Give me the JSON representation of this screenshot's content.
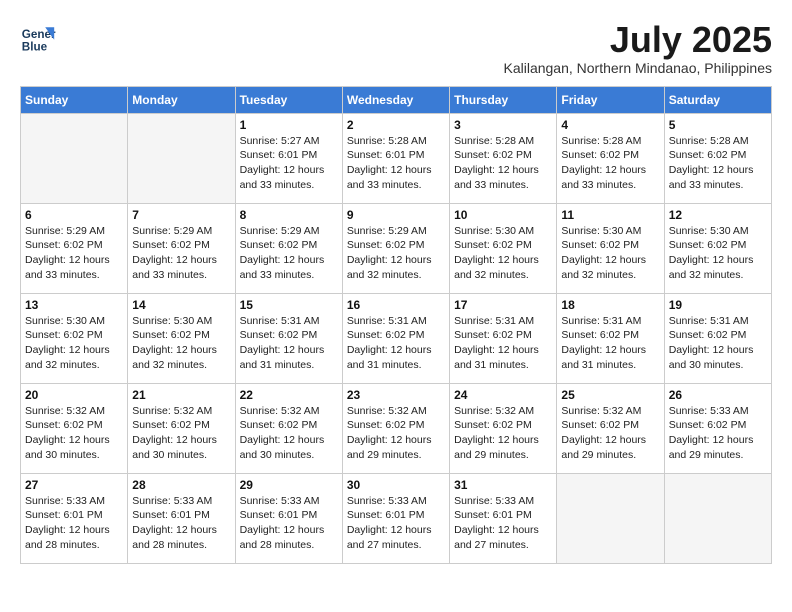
{
  "header": {
    "logo_line1": "General",
    "logo_line2": "Blue",
    "month": "July 2025",
    "location": "Kalilangan, Northern Mindanao, Philippines"
  },
  "weekdays": [
    "Sunday",
    "Monday",
    "Tuesday",
    "Wednesday",
    "Thursday",
    "Friday",
    "Saturday"
  ],
  "weeks": [
    [
      {
        "day": "",
        "info": ""
      },
      {
        "day": "",
        "info": ""
      },
      {
        "day": "1",
        "info": "Sunrise: 5:27 AM\nSunset: 6:01 PM\nDaylight: 12 hours and 33 minutes."
      },
      {
        "day": "2",
        "info": "Sunrise: 5:28 AM\nSunset: 6:01 PM\nDaylight: 12 hours and 33 minutes."
      },
      {
        "day": "3",
        "info": "Sunrise: 5:28 AM\nSunset: 6:02 PM\nDaylight: 12 hours and 33 minutes."
      },
      {
        "day": "4",
        "info": "Sunrise: 5:28 AM\nSunset: 6:02 PM\nDaylight: 12 hours and 33 minutes."
      },
      {
        "day": "5",
        "info": "Sunrise: 5:28 AM\nSunset: 6:02 PM\nDaylight: 12 hours and 33 minutes."
      }
    ],
    [
      {
        "day": "6",
        "info": "Sunrise: 5:29 AM\nSunset: 6:02 PM\nDaylight: 12 hours and 33 minutes."
      },
      {
        "day": "7",
        "info": "Sunrise: 5:29 AM\nSunset: 6:02 PM\nDaylight: 12 hours and 33 minutes."
      },
      {
        "day": "8",
        "info": "Sunrise: 5:29 AM\nSunset: 6:02 PM\nDaylight: 12 hours and 33 minutes."
      },
      {
        "day": "9",
        "info": "Sunrise: 5:29 AM\nSunset: 6:02 PM\nDaylight: 12 hours and 32 minutes."
      },
      {
        "day": "10",
        "info": "Sunrise: 5:30 AM\nSunset: 6:02 PM\nDaylight: 12 hours and 32 minutes."
      },
      {
        "day": "11",
        "info": "Sunrise: 5:30 AM\nSunset: 6:02 PM\nDaylight: 12 hours and 32 minutes."
      },
      {
        "day": "12",
        "info": "Sunrise: 5:30 AM\nSunset: 6:02 PM\nDaylight: 12 hours and 32 minutes."
      }
    ],
    [
      {
        "day": "13",
        "info": "Sunrise: 5:30 AM\nSunset: 6:02 PM\nDaylight: 12 hours and 32 minutes."
      },
      {
        "day": "14",
        "info": "Sunrise: 5:30 AM\nSunset: 6:02 PM\nDaylight: 12 hours and 32 minutes."
      },
      {
        "day": "15",
        "info": "Sunrise: 5:31 AM\nSunset: 6:02 PM\nDaylight: 12 hours and 31 minutes."
      },
      {
        "day": "16",
        "info": "Sunrise: 5:31 AM\nSunset: 6:02 PM\nDaylight: 12 hours and 31 minutes."
      },
      {
        "day": "17",
        "info": "Sunrise: 5:31 AM\nSunset: 6:02 PM\nDaylight: 12 hours and 31 minutes."
      },
      {
        "day": "18",
        "info": "Sunrise: 5:31 AM\nSunset: 6:02 PM\nDaylight: 12 hours and 31 minutes."
      },
      {
        "day": "19",
        "info": "Sunrise: 5:31 AM\nSunset: 6:02 PM\nDaylight: 12 hours and 30 minutes."
      }
    ],
    [
      {
        "day": "20",
        "info": "Sunrise: 5:32 AM\nSunset: 6:02 PM\nDaylight: 12 hours and 30 minutes."
      },
      {
        "day": "21",
        "info": "Sunrise: 5:32 AM\nSunset: 6:02 PM\nDaylight: 12 hours and 30 minutes."
      },
      {
        "day": "22",
        "info": "Sunrise: 5:32 AM\nSunset: 6:02 PM\nDaylight: 12 hours and 30 minutes."
      },
      {
        "day": "23",
        "info": "Sunrise: 5:32 AM\nSunset: 6:02 PM\nDaylight: 12 hours and 29 minutes."
      },
      {
        "day": "24",
        "info": "Sunrise: 5:32 AM\nSunset: 6:02 PM\nDaylight: 12 hours and 29 minutes."
      },
      {
        "day": "25",
        "info": "Sunrise: 5:32 AM\nSunset: 6:02 PM\nDaylight: 12 hours and 29 minutes."
      },
      {
        "day": "26",
        "info": "Sunrise: 5:33 AM\nSunset: 6:02 PM\nDaylight: 12 hours and 29 minutes."
      }
    ],
    [
      {
        "day": "27",
        "info": "Sunrise: 5:33 AM\nSunset: 6:01 PM\nDaylight: 12 hours and 28 minutes."
      },
      {
        "day": "28",
        "info": "Sunrise: 5:33 AM\nSunset: 6:01 PM\nDaylight: 12 hours and 28 minutes."
      },
      {
        "day": "29",
        "info": "Sunrise: 5:33 AM\nSunset: 6:01 PM\nDaylight: 12 hours and 28 minutes."
      },
      {
        "day": "30",
        "info": "Sunrise: 5:33 AM\nSunset: 6:01 PM\nDaylight: 12 hours and 27 minutes."
      },
      {
        "day": "31",
        "info": "Sunrise: 5:33 AM\nSunset: 6:01 PM\nDaylight: 12 hours and 27 minutes."
      },
      {
        "day": "",
        "info": ""
      },
      {
        "day": "",
        "info": ""
      }
    ]
  ]
}
